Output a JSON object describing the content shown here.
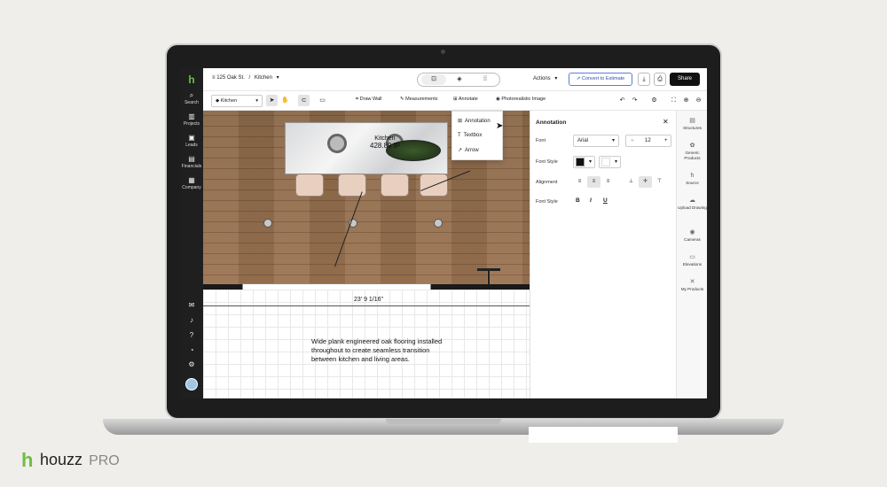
{
  "brand": {
    "name": "houzz",
    "suffix": "PRO",
    "logo_letter": "h",
    "color": "#6ebe44"
  },
  "nav": {
    "items": [
      {
        "label": "Search",
        "icon": "search-icon"
      },
      {
        "label": "Projects",
        "icon": "projects-icon"
      },
      {
        "label": "Leads",
        "icon": "leads-icon"
      },
      {
        "label": "Financials",
        "icon": "financials-icon"
      },
      {
        "label": "Company",
        "icon": "company-icon"
      }
    ]
  },
  "header": {
    "project": "125 Oak St.",
    "separator": "/",
    "room": "Kitchen",
    "actions_label": "Actions",
    "convert_label": "Convert to Estimate",
    "share_label": "Share"
  },
  "toolbar": {
    "level": "Kitchen",
    "draw_wall": "Draw Wall",
    "measurements": "Measurements",
    "annotate": "Annotate",
    "photo": "Photorealistic Image"
  },
  "annotate_menu": {
    "items": [
      "Annotation",
      "Textbox",
      "Arrow"
    ]
  },
  "canvas": {
    "room_name": "Kitchen",
    "room_area": "428.89 ft²",
    "dimension": "23' 9 1/16\"",
    "note": "Wide plank engineered oak flooring installed throughout to create seamless transition between kitchen and living areas."
  },
  "panel": {
    "title": "Annotation",
    "font_label": "Font",
    "font_value": "Arial",
    "size_value": "12",
    "font_style_label": "Font Style",
    "alignment_label": "Alignment",
    "font_style2_label": "Font Style",
    "bold": "B",
    "italic": "I",
    "underline": "U"
  },
  "rail": {
    "items": [
      "Structures",
      "Generic Products",
      "Source",
      "Upload Drawing",
      "Cameras",
      "Elevations",
      "My Products"
    ]
  }
}
